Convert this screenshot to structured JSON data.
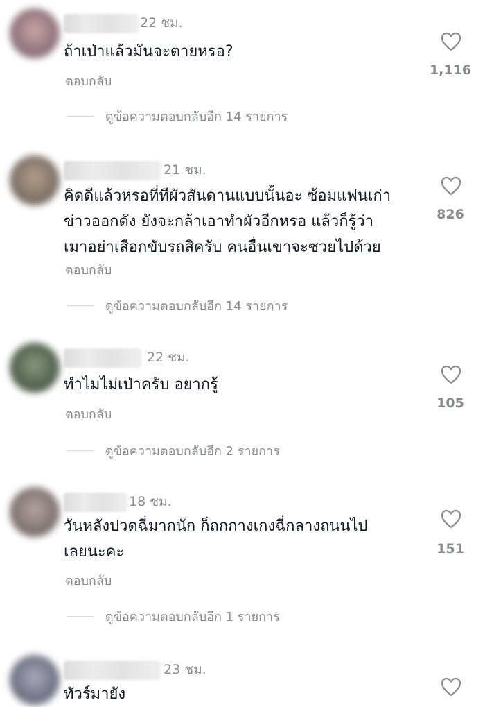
{
  "comments": [
    {
      "time": "22 ชม.",
      "lines": [
        "ถ้าเป่าแล้วมันจะตายหรอ?"
      ],
      "reply_label": "ตอบกลับ",
      "likes": "1,116",
      "more_replies": "ดูข้อความตอบกลับอีก 14 รายการ",
      "avatar_color": "#a58a92"
    },
    {
      "time": "21 ชม.",
      "lines": [
        "คิดดีแล้วหรอที่ทีผัวสันดานแบบนั้นอะ ซ้อมแฟนเก่า",
        "ข่าวออกดัง ยังจะกล้าเอาทำผัวอีกหรอ แล้วก็รู้ว่า",
        "เมาอย่าเสือกขับรถสิครับ คนอื่นเขาจะซวยไปด้วย"
      ],
      "reply_label": "ตอบกลับ",
      "likes": "826",
      "more_replies": "ดูข้อความตอบกลับอีก 14 รายการ",
      "avatar_color": "#8b7c70"
    },
    {
      "time": "22 ชม.",
      "lines": [
        "ทำไมไม่เป่าครับ อยากรู้"
      ],
      "reply_label": "ตอบกลับ",
      "likes": "105",
      "more_replies": "ดูข้อความตอบกลับอีก 2 รายการ",
      "avatar_color": "#5d6d58"
    },
    {
      "time": "18 ชม.",
      "lines": [
        "วันหลังปวดฉี่มากนัก ก็ถกกางเกงฉี่กลางถนนไป",
        "เลยนะคะ"
      ],
      "reply_label": "ตอบกลับ",
      "likes": "151",
      "more_replies": "ดูข้อความตอบกลับอีก 1 รายการ",
      "avatar_color": "#8c7f7c"
    },
    {
      "time": "23 ชม.",
      "lines": [
        "ทัวร์มายัง"
      ],
      "reply_label": "",
      "likes": "",
      "more_replies": "",
      "avatar_color": "#7c7f90"
    }
  ]
}
